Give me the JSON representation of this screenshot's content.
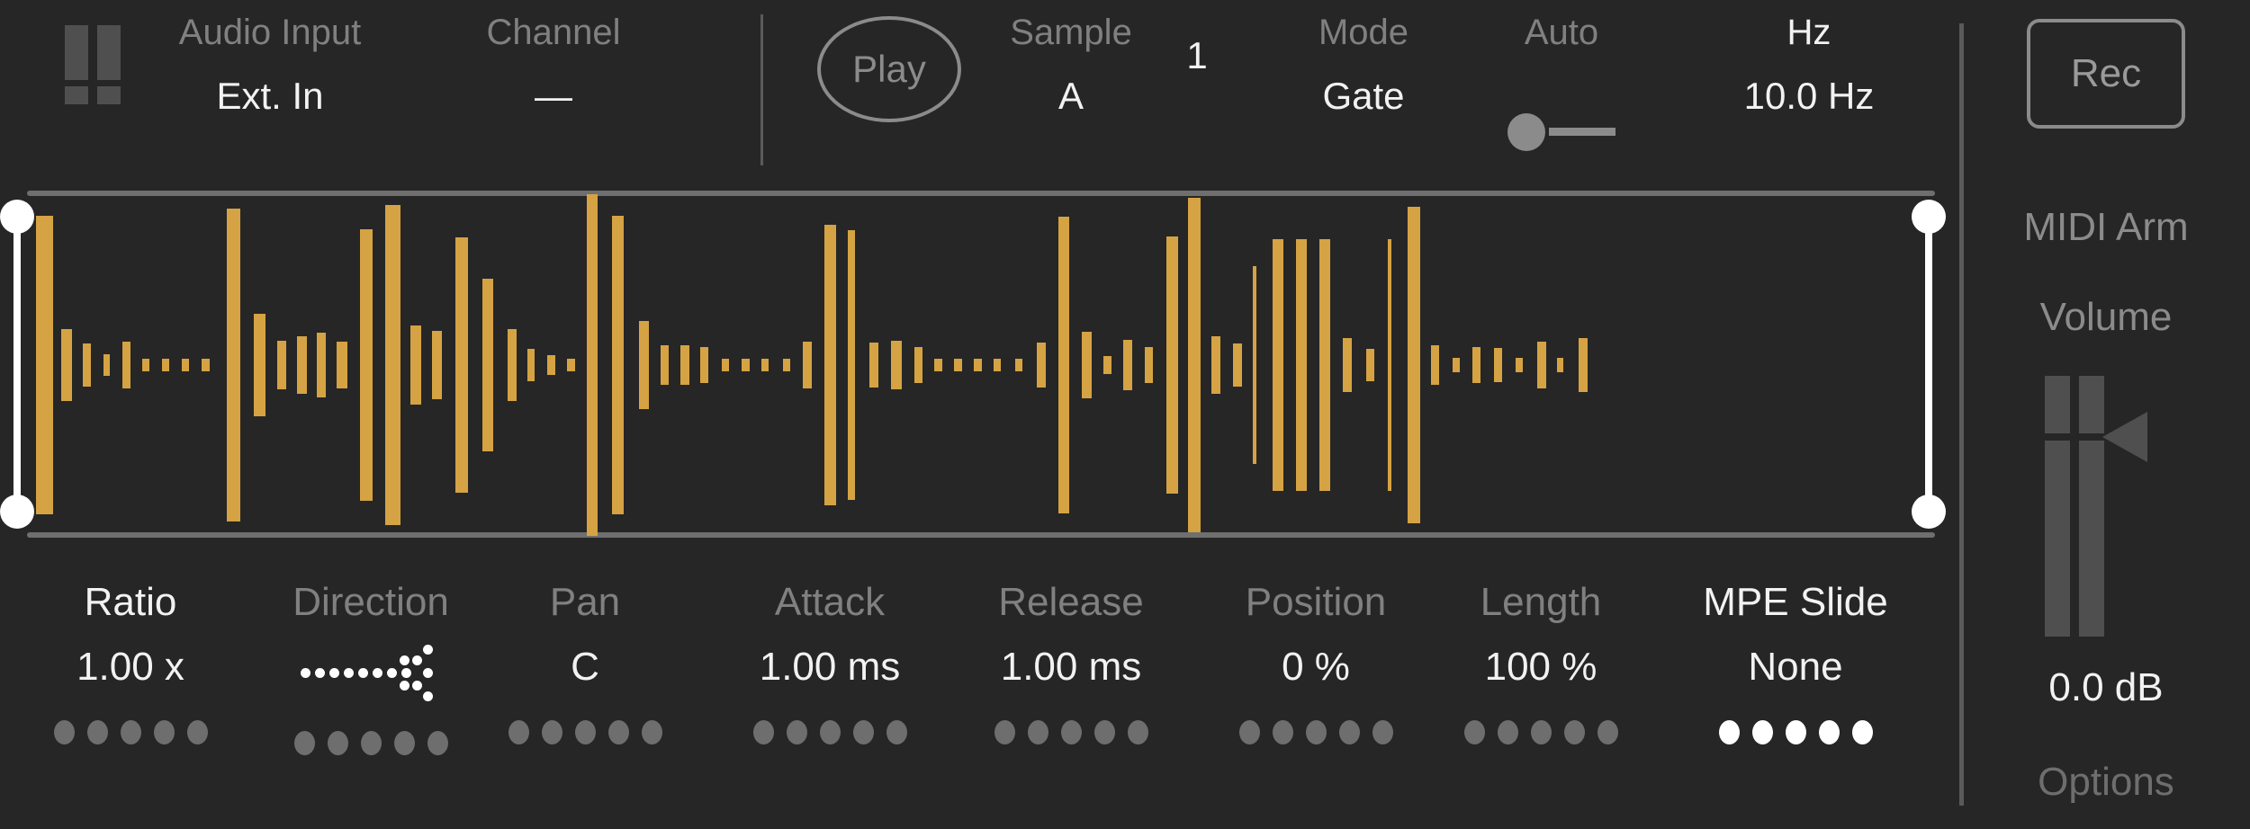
{
  "theme": {
    "background": "#262626",
    "accent_waveform": "#d5a343",
    "text_active": "#f2f2f2",
    "text_dim": "#808080",
    "outline": "#8b8b8b"
  },
  "header": {
    "fader_icon": "fader-icon",
    "items": [
      {
        "label": "Audio Input",
        "value": "Ext. In",
        "label_active": false
      },
      {
        "label": "Channel",
        "value": "—",
        "label_active": false
      },
      {
        "label": "Sample",
        "value": "A",
        "label_active": false
      },
      {
        "label": "",
        "value": "1",
        "label_active": false
      },
      {
        "label": "Mode",
        "value": "Gate",
        "label_active": false
      },
      {
        "label": "Auto",
        "value": "",
        "label_active": false
      },
      {
        "label": "Hz",
        "value": "10.0 Hz",
        "label_active": true
      }
    ],
    "play_button": {
      "label": "Play"
    },
    "auto_toggle": {
      "state": "off"
    }
  },
  "waveform": {
    "selection_left_handle": "selection-handle-left",
    "selection_right_handle": "selection-handle-right",
    "bar_color": "#d5a343",
    "bars": [
      [
        10,
        19,
        166
      ],
      [
        38,
        12,
        40
      ],
      [
        62,
        9,
        24
      ],
      [
        85,
        7,
        12
      ],
      [
        106,
        9,
        26
      ],
      [
        128,
        8,
        7
      ],
      [
        150,
        8,
        7
      ],
      [
        172,
        8,
        7
      ],
      [
        194,
        9,
        7
      ],
      [
        222,
        15,
        174
      ],
      [
        252,
        13,
        57
      ],
      [
        278,
        10,
        27
      ],
      [
        300,
        11,
        32
      ],
      [
        322,
        10,
        36
      ],
      [
        344,
        12,
        26
      ],
      [
        370,
        14,
        151
      ],
      [
        398,
        17,
        178
      ],
      [
        426,
        12,
        44
      ],
      [
        450,
        11,
        38
      ],
      [
        476,
        14,
        142
      ],
      [
        506,
        12,
        96
      ],
      [
        534,
        10,
        40
      ],
      [
        556,
        8,
        18
      ],
      [
        578,
        9,
        11
      ],
      [
        600,
        9,
        7
      ],
      [
        622,
        12,
        190
      ],
      [
        650,
        13,
        166
      ],
      [
        680,
        11,
        49
      ],
      [
        704,
        9,
        22
      ],
      [
        726,
        10,
        22
      ],
      [
        748,
        9,
        20
      ],
      [
        772,
        8,
        7
      ],
      [
        794,
        9,
        7
      ],
      [
        816,
        8,
        7
      ],
      [
        840,
        8,
        7
      ],
      [
        862,
        10,
        26
      ],
      [
        886,
        13,
        156
      ],
      [
        912,
        8,
        150
      ],
      [
        936,
        10,
        25
      ],
      [
        960,
        12,
        27
      ],
      [
        986,
        9,
        20
      ],
      [
        1008,
        9,
        7
      ],
      [
        1030,
        9,
        7
      ],
      [
        1052,
        9,
        7
      ],
      [
        1074,
        8,
        7
      ],
      [
        1098,
        8,
        7
      ],
      [
        1122,
        10,
        25
      ],
      [
        1146,
        12,
        165
      ],
      [
        1172,
        11,
        37
      ],
      [
        1196,
        9,
        10
      ],
      [
        1218,
        10,
        28
      ],
      [
        1242,
        9,
        20
      ],
      [
        1266,
        13,
        143
      ],
      [
        1290,
        14,
        186
      ],
      [
        1316,
        10,
        32
      ],
      [
        1340,
        10,
        24
      ],
      [
        1362,
        4,
        110
      ],
      [
        1384,
        12,
        140
      ],
      [
        1410,
        12,
        140
      ],
      [
        1436,
        12,
        140
      ],
      [
        1462,
        10,
        30
      ],
      [
        1488,
        9,
        18
      ],
      [
        1512,
        4,
        140
      ],
      [
        1534,
        14,
        176
      ],
      [
        1560,
        9,
        22
      ],
      [
        1584,
        8,
        8
      ],
      [
        1606,
        9,
        20
      ],
      [
        1630,
        9,
        19
      ],
      [
        1654,
        8,
        8
      ],
      [
        1678,
        10,
        26
      ],
      [
        1700,
        7,
        8
      ],
      [
        1724,
        10,
        30
      ]
    ]
  },
  "parameters": [
    {
      "name": "Ratio",
      "value": "1.00 x",
      "name_active": true,
      "dots_active": false,
      "value_type": "text"
    },
    {
      "name": "Direction",
      "value": "",
      "name_active": false,
      "dots_active": false,
      "value_type": "arrow-right-dotted-icon"
    },
    {
      "name": "Pan",
      "value": "C",
      "name_active": false,
      "dots_active": false,
      "value_type": "text"
    },
    {
      "name": "Attack",
      "value": "1.00 ms",
      "name_active": false,
      "dots_active": false,
      "value_type": "text"
    },
    {
      "name": "Release",
      "value": "1.00 ms",
      "name_active": false,
      "dots_active": false,
      "value_type": "text"
    },
    {
      "name": "Position",
      "value": "0 %",
      "name_active": false,
      "dots_active": false,
      "value_type": "text"
    },
    {
      "name": "Length",
      "value": "100 %",
      "name_active": false,
      "dots_active": false,
      "value_type": "text"
    },
    {
      "name": "MPE Slide",
      "value": "None",
      "name_active": true,
      "dots_active": true,
      "value_type": "text"
    }
  ],
  "right_panel": {
    "rec_button_label": "Rec",
    "midi_arm_label": "MIDI Arm",
    "volume_label": "Volume",
    "volume_value": "0.0 dB",
    "options_label": "Options",
    "volume_fader_icon": "vertical-fader-icon"
  }
}
